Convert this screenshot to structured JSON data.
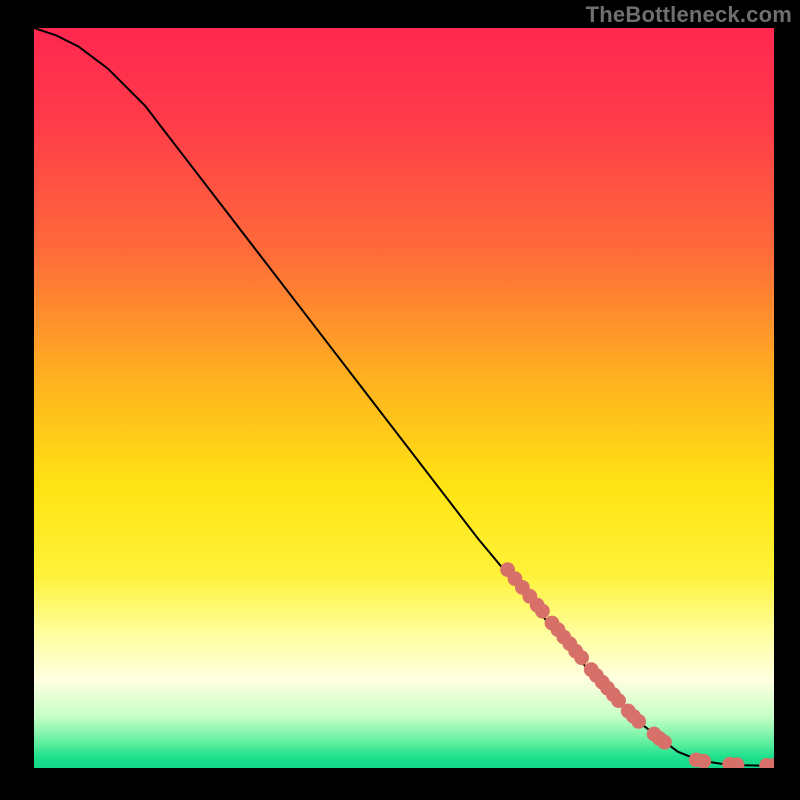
{
  "attribution": "TheBottleneck.com",
  "chart_data": {
    "type": "line",
    "title": "",
    "xlabel": "",
    "ylabel": "",
    "xlim": [
      0,
      100
    ],
    "ylim": [
      0,
      100
    ],
    "curve": [
      {
        "x": 0,
        "y": 100
      },
      {
        "x": 3,
        "y": 99
      },
      {
        "x": 6,
        "y": 97.5
      },
      {
        "x": 10,
        "y": 94.5
      },
      {
        "x": 15,
        "y": 89.5
      },
      {
        "x": 20,
        "y": 83
      },
      {
        "x": 30,
        "y": 70
      },
      {
        "x": 40,
        "y": 57
      },
      {
        "x": 50,
        "y": 44
      },
      {
        "x": 60,
        "y": 31
      },
      {
        "x": 70,
        "y": 19
      },
      {
        "x": 76,
        "y": 12
      },
      {
        "x": 82,
        "y": 6
      },
      {
        "x": 87,
        "y": 2.2
      },
      {
        "x": 90,
        "y": 1
      },
      {
        "x": 94,
        "y": 0.4
      },
      {
        "x": 100,
        "y": 0.3
      }
    ],
    "highlight_dots_on_curve": [
      {
        "x": 64,
        "y": 26.8
      },
      {
        "x": 65,
        "y": 25.6
      },
      {
        "x": 66,
        "y": 24.4
      },
      {
        "x": 67,
        "y": 23.2
      },
      {
        "x": 68,
        "y": 22.0
      },
      {
        "x": 68.7,
        "y": 21.2
      },
      {
        "x": 70.0,
        "y": 19.6
      },
      {
        "x": 70.8,
        "y": 18.7
      },
      {
        "x": 71.6,
        "y": 17.7
      },
      {
        "x": 72.4,
        "y": 16.8
      },
      {
        "x": 73.2,
        "y": 15.8
      },
      {
        "x": 74.0,
        "y": 14.9
      },
      {
        "x": 75.3,
        "y": 13.3
      },
      {
        "x": 76.0,
        "y": 12.5
      },
      {
        "x": 76.8,
        "y": 11.6
      },
      {
        "x": 77.5,
        "y": 10.8
      },
      {
        "x": 78.3,
        "y": 9.9
      },
      {
        "x": 79.0,
        "y": 9.1
      },
      {
        "x": 80.3,
        "y": 7.7
      },
      {
        "x": 81.0,
        "y": 7.0
      },
      {
        "x": 81.7,
        "y": 6.3
      },
      {
        "x": 83.8,
        "y": 4.6
      },
      {
        "x": 84.5,
        "y": 4.0
      },
      {
        "x": 85.2,
        "y": 3.5
      }
    ],
    "flat_tail_dots": [
      {
        "x": 89.5,
        "y": 1.1
      },
      {
        "x": 90.5,
        "y": 0.9
      },
      {
        "x": 94.0,
        "y": 0.5
      },
      {
        "x": 95.0,
        "y": 0.45
      },
      {
        "x": 99.0,
        "y": 0.35
      },
      {
        "x": 100.0,
        "y": 0.35
      }
    ],
    "gradient_stops": [
      {
        "offset": 0.0,
        "color": "#ff2850"
      },
      {
        "offset": 0.12,
        "color": "#ff3a4a"
      },
      {
        "offset": 0.3,
        "color": "#ff6a3a"
      },
      {
        "offset": 0.48,
        "color": "#ffb31f"
      },
      {
        "offset": 0.62,
        "color": "#ffe413"
      },
      {
        "offset": 0.74,
        "color": "#fff23a"
      },
      {
        "offset": 0.82,
        "color": "#ffffa0"
      },
      {
        "offset": 0.88,
        "color": "#ffffe0"
      },
      {
        "offset": 0.93,
        "color": "#c8ffc8"
      },
      {
        "offset": 0.965,
        "color": "#62f0a0"
      },
      {
        "offset": 0.985,
        "color": "#1ee08d"
      },
      {
        "offset": 1.0,
        "color": "#13d88a"
      }
    ],
    "dot_color": "#d8706a",
    "curve_color": "#000000"
  }
}
